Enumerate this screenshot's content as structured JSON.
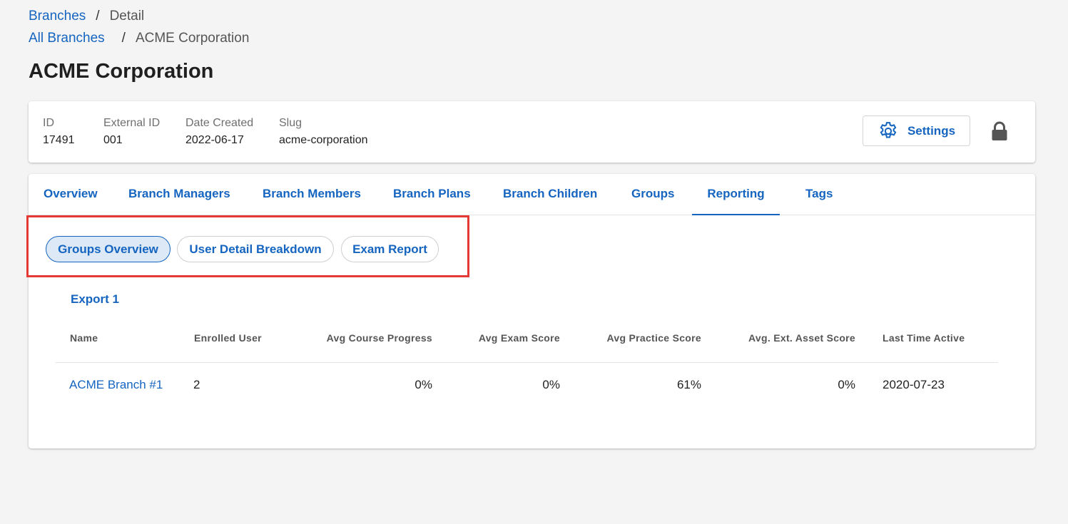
{
  "breadcrumbs": [
    {
      "link": "Branches",
      "current": "Detail"
    },
    {
      "link": "All Branches",
      "current": "ACME Corporation"
    }
  ],
  "breadcrumb_separator": "/",
  "page_title": "ACME Corporation",
  "info": {
    "fields": [
      {
        "label": "ID",
        "value": "17491"
      },
      {
        "label": "External ID",
        "value": "001"
      },
      {
        "label": "Date Created",
        "value": "2022-06-17"
      },
      {
        "label": "Slug",
        "value": "acme-corporation"
      }
    ],
    "settings_label": "Settings",
    "settings_icon": "gear-icon",
    "lock_icon": "lock-icon"
  },
  "tabs": [
    "Overview",
    "Branch Managers",
    "Branch Members",
    "Branch Plans",
    "Branch Children",
    "Groups",
    "Reporting",
    "Tags"
  ],
  "active_tab": "Reporting",
  "subtabs": [
    "Groups Overview",
    "User Detail Breakdown",
    "Exam Report"
  ],
  "active_subtab": "Groups Overview",
  "export_label": "Export 1",
  "table": {
    "columns": [
      "Name",
      "Enrolled User",
      "Avg Course Progress",
      "Avg Exam Score",
      "Avg Practice Score",
      "Avg. Ext. Asset Score",
      "Last Time Active"
    ],
    "rows": [
      [
        "ACME Branch #1",
        "2",
        "0%",
        "0%",
        "61%",
        "0%",
        "2020-07-23"
      ]
    ]
  },
  "colors": {
    "accent": "#1565c0",
    "highlight": "#e53935",
    "background": "#f4f4f4"
  }
}
